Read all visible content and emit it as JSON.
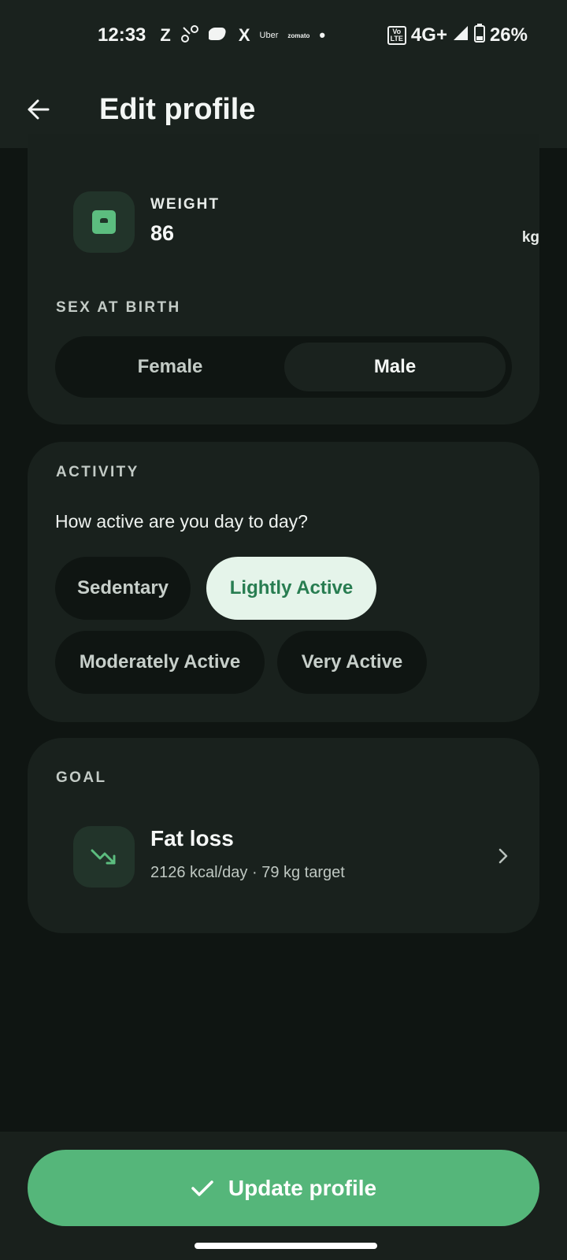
{
  "status_bar": {
    "time": "12:33",
    "apps": [
      "Z",
      "X",
      "Uber",
      "zomato"
    ],
    "network": "4G+",
    "volte": "Vo\nLTE",
    "battery": "26%"
  },
  "header": {
    "title": "Edit profile"
  },
  "body_card": {
    "weight_label": "WEIGHT",
    "weight_value": "86",
    "weight_unit": "kg",
    "sex_label": "SEX AT BIRTH",
    "sex_options": [
      "Female",
      "Male"
    ],
    "sex_selected": "Male"
  },
  "activity": {
    "section_label": "ACTIVITY",
    "question": "How active are you day to day?",
    "options": [
      "Sedentary",
      "Lightly Active",
      "Moderately Active",
      "Very Active"
    ],
    "selected": "Lightly Active"
  },
  "goal": {
    "section_label": "GOAL",
    "title": "Fat loss",
    "subtitle": "2126 kcal/day · 79 kg target"
  },
  "footer": {
    "update_label": "Update profile"
  },
  "colors": {
    "accent": "#55b67a",
    "background": "#0f1512",
    "card": "#19211d",
    "chip_selected_bg": "#e5f4ea",
    "chip_selected_text": "#287d51"
  }
}
